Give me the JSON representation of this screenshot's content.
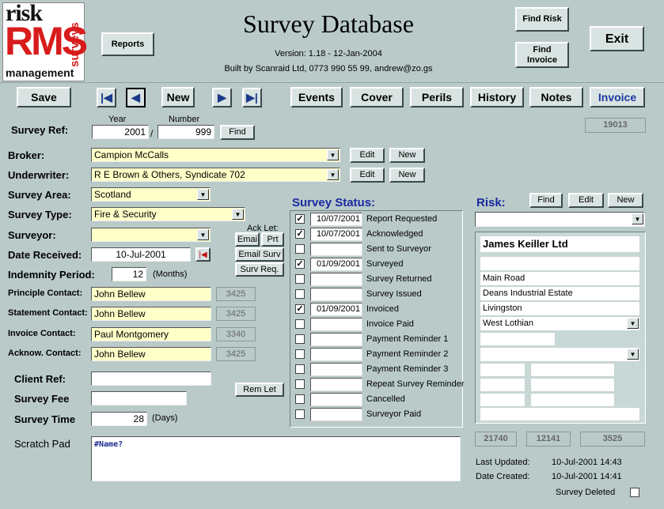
{
  "header": {
    "logo_risk": "risk",
    "logo_rms": "RMS",
    "logo_surveys": "surveys",
    "logo_management": "management",
    "title": "Survey Database",
    "version": "Version: 1.18 - 12-Jan-2004",
    "built_by": "Built by Scanraid  Ltd, 0773 990 55 99, andrew@zo.gs",
    "reports": "Reports",
    "find_risk": "Find Risk",
    "find_invoice": "Find Invoice",
    "exit": "Exit"
  },
  "toolbar": {
    "save": "Save",
    "new": "New",
    "events": "Events",
    "cover": "Cover",
    "perils": "Perils",
    "history": "History",
    "notes": "Notes",
    "invoice": "Invoice"
  },
  "survey_ref": {
    "label": "Survey Ref:",
    "year_label": "Year",
    "number_label": "Number",
    "year": "2001",
    "slash": "/",
    "number": "999",
    "find": "Find",
    "id": "19013"
  },
  "fields": {
    "broker_label": "Broker:",
    "broker": "Campion McCalls",
    "underwriter_label": "Underwriter:",
    "underwriter": "R E Brown & Others, Syndicate 702",
    "edit": "Edit",
    "new": "New",
    "area_label": "Survey Area:",
    "area": "Scotland",
    "type_label": "Survey Type:",
    "type": "Fire & Security",
    "surveyor_label": "Surveyor:",
    "surveyor": "",
    "date_label": "Date Received:",
    "date": "10-Jul-2001",
    "indemnity_label": "Indemnity Period:",
    "indemnity": "12",
    "months": "(Months)",
    "ack_let": "Ack Let:",
    "emai": "Emai",
    "prt": "Prt",
    "email_surv": "Email Surv",
    "surv_req": "Surv Req.",
    "rem_let": "Rem Let"
  },
  "contacts": [
    {
      "label": "Principle Contact:",
      "name": "John Bellew",
      "code": "3425"
    },
    {
      "label": "Statement Contact:",
      "name": "John Bellew",
      "code": "3425"
    },
    {
      "label": "Invoice Contact:",
      "name": "Paul Montgomery",
      "code": "3340"
    },
    {
      "label": "Acknow. Contact:",
      "name": "John Bellew",
      "code": "3425"
    }
  ],
  "bottom": {
    "client_ref_label": "Client Ref:",
    "client_ref": "",
    "fee_label": "Survey Fee",
    "fee": "",
    "time_label": "Survey Time",
    "time": "28",
    "days": "(Days)",
    "scratch_label": "Scratch Pad",
    "scratch": "#Name?"
  },
  "status": {
    "title": "Survey Status:",
    "items": [
      {
        "checked": "✓",
        "date": "10/07/2001",
        "label": "Report Requested"
      },
      {
        "checked": "✓",
        "date": "10/07/2001",
        "label": "Acknowledged"
      },
      {
        "checked": "",
        "date": "",
        "label": "Sent to Surveyor"
      },
      {
        "checked": "✓",
        "date": "01/09/2001",
        "label": "Surveyed"
      },
      {
        "checked": "",
        "date": "",
        "label": "Survey Returned"
      },
      {
        "checked": "",
        "date": "",
        "label": "Survey Issued"
      },
      {
        "checked": "✓",
        "date": "01/09/2001",
        "label": "Invoiced"
      },
      {
        "checked": "",
        "date": "",
        "label": "Invoice Paid"
      },
      {
        "checked": "",
        "date": "",
        "label": "Payment Reminder 1"
      },
      {
        "checked": "",
        "date": "",
        "label": "Payment Reminder 2"
      },
      {
        "checked": "",
        "date": "",
        "label": "Payment Reminder 3"
      },
      {
        "checked": "",
        "date": "",
        "label": "Repeat Survey Reminder"
      },
      {
        "checked": "",
        "date": "",
        "label": "Cancelled"
      },
      {
        "checked": "",
        "date": "",
        "label": "Surveyor Paid"
      }
    ]
  },
  "risk": {
    "label": "Risk:",
    "find": "Find",
    "edit": "Edit",
    "new": "New",
    "name": "James Keiller Ltd",
    "line1": "",
    "line2": "Main Road",
    "line3": "Deans Industrial Estate",
    "line4": "Livingston",
    "line5": "West Lothian",
    "id1": "21740",
    "id2": "12141",
    "id3": "3525",
    "last_updated_label": "Last Updated:",
    "last_updated": "10-Jul-2001 14:43",
    "created_label": "Date Created:",
    "created": "10-Jul-2001 14:41",
    "deleted_label": "Survey Deleted"
  }
}
